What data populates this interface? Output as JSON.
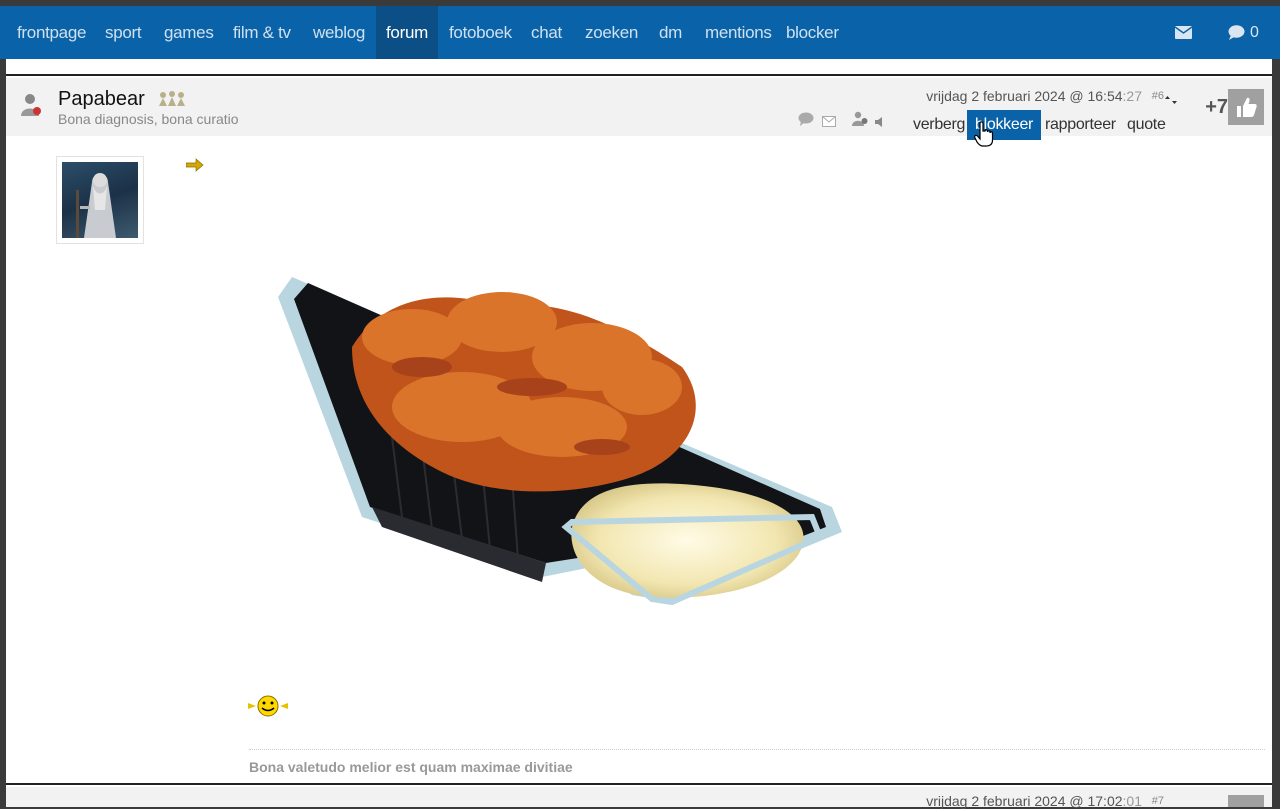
{
  "nav": {
    "items": [
      {
        "label": "frontpage"
      },
      {
        "label": "sport"
      },
      {
        "label": "games"
      },
      {
        "label": "film & tv"
      },
      {
        "label": "weblog"
      },
      {
        "label": "forum"
      },
      {
        "label": "fotoboek"
      },
      {
        "label": "chat"
      },
      {
        "label": "zoeken"
      },
      {
        "label": "dm"
      },
      {
        "label": "mentions"
      },
      {
        "label": "blocker"
      }
    ],
    "active": "forum",
    "notifications_count": "0"
  },
  "post": {
    "username": "Papabear",
    "subtitle": "Bona diagnosis, bona curatio",
    "date_main": "vrijdag 2 februari 2024 @ 16:54",
    "date_seconds": ":27",
    "post_number": "#6",
    "actions": {
      "hide": "verberg",
      "block": "blokkeer",
      "report": "rapporteer",
      "quote": "quote"
    },
    "votes": "+7",
    "signature": "Bona valetudo melior est quam maximae divitiae"
  },
  "next_post": {
    "date_main": "vrijdag 2 februari 2024 @ 17:02",
    "date_seconds": ":01",
    "post_number": "#7"
  },
  "colors": {
    "navbar": "#0a63a8",
    "nav_active": "#0b4f86",
    "selected_action": "#0a63a8"
  }
}
